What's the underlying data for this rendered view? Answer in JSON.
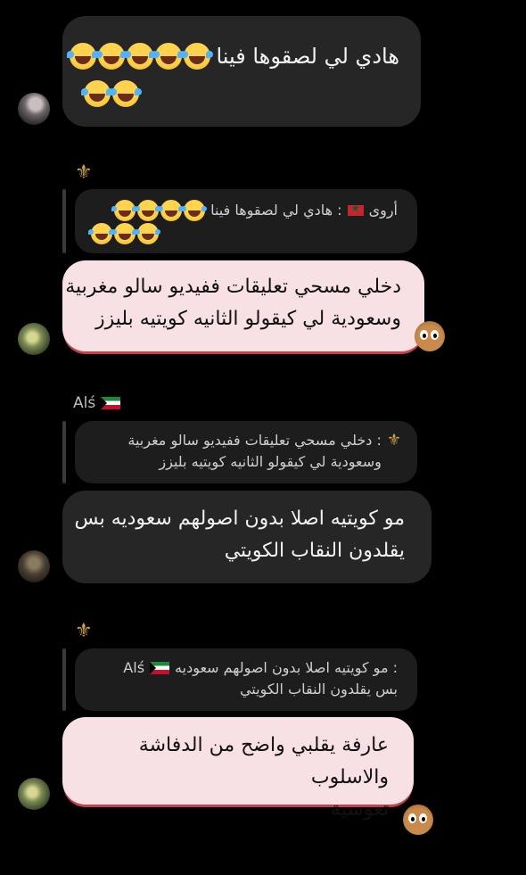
{
  "messages": [
    {
      "text": "هادي لي لصقوها فينا",
      "emoji_count_line1": 5,
      "emoji_count_line2": 2,
      "emoji": "laughing-with-tears-emoji"
    },
    {
      "reply_sender": "أروى",
      "reply_text": ": هادي لي لصقوها فينا",
      "reply_emoji_count_line1": 4,
      "reply_emoji_count_line2": 3,
      "text": "دخلي مسحي تعليقات ففيديو سالو مغربية\nوسعودية لي كيقولو الثانيه كويتيه بليزز"
    },
    {
      "username": "Alś",
      "reply_text": ": دخلي مسحي تعليقات ففيديو سالو مغربية\nوسعودية لي كيقولو الثانيه كويتيه بليزز",
      "text": "مو كويتيه اصلا بدون اصولهم سعوديه بس\nيقلدون النقاب الكويتي"
    },
    {
      "reply_sender": "Alś",
      "reply_text": ": مو كويتيه اصلا بدون اصولهم سعوديه\nبس يقلدون النقاب الكويتي",
      "text": "عارفة يقلبي واضح من الدفاشة والاسلوب\nتعوسية"
    }
  ],
  "colors": {
    "background": "#000000",
    "dark_bubble": "#262626",
    "pink_bubble": "#f8e1e4",
    "pink_bubble_shadow": "#c4404c",
    "fleur_gold": "#c9a24b"
  },
  "icons": {
    "fleur": "fleur-de-lis-icon",
    "flag_kuwait": "kuwait-flag-icon",
    "flag_morocco": "morocco-flag-icon",
    "sticker": "bear-sticker-icon"
  }
}
